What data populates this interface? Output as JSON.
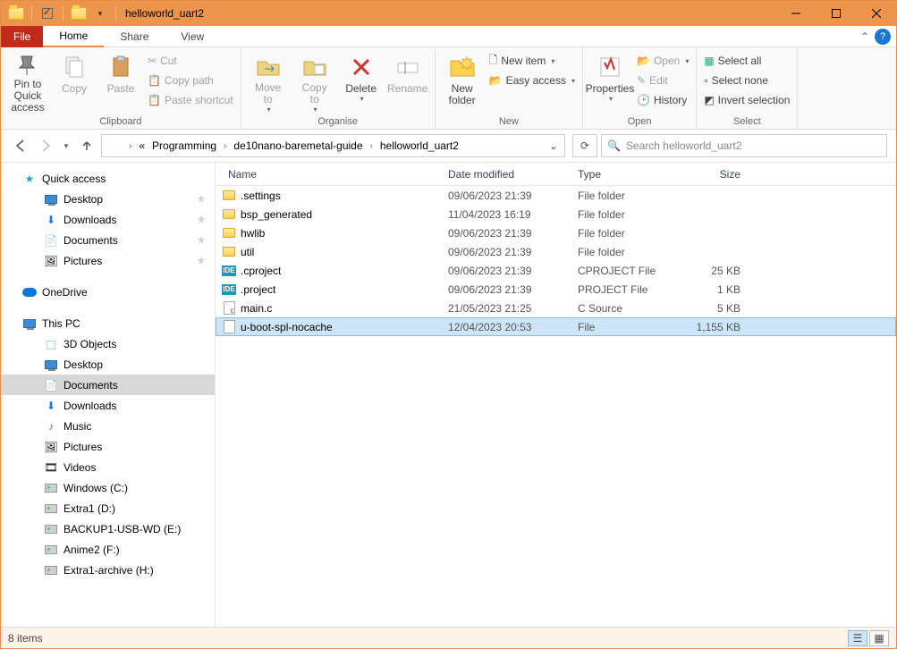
{
  "window": {
    "title": "helloworld_uart2"
  },
  "tabs": {
    "file": "File",
    "home": "Home",
    "share": "Share",
    "view": "View"
  },
  "ribbon": {
    "clipboard": {
      "pin": "Pin to Quick\naccess",
      "copy": "Copy",
      "paste": "Paste",
      "cut": "Cut",
      "copypath": "Copy path",
      "pasteshortcut": "Paste shortcut",
      "label": "Clipboard"
    },
    "organise": {
      "moveto": "Move\nto",
      "copyto": "Copy\nto",
      "delete": "Delete",
      "rename": "Rename",
      "label": "Organise"
    },
    "new": {
      "newfolder": "New\nfolder",
      "newitem": "New item",
      "easyaccess": "Easy access",
      "label": "New"
    },
    "open": {
      "properties": "Properties",
      "open": "Open",
      "edit": "Edit",
      "history": "History",
      "label": "Open"
    },
    "select": {
      "selectall": "Select all",
      "selectnone": "Select none",
      "invert": "Invert selection",
      "label": "Select"
    }
  },
  "breadcrumb": {
    "seg0": "«",
    "seg1": "Programming",
    "seg2": "de10nano-baremetal-guide",
    "seg3": "helloworld_uart2"
  },
  "search": {
    "placeholder": "Search helloworld_uart2"
  },
  "nav": {
    "quickaccess": "Quick access",
    "desktop": "Desktop",
    "downloads": "Downloads",
    "documents": "Documents",
    "pictures": "Pictures",
    "onedrive": "OneDrive",
    "thispc": "This PC",
    "objects3d": "3D Objects",
    "desktop2": "Desktop",
    "documents2": "Documents",
    "downloads2": "Downloads",
    "music": "Music",
    "pictures2": "Pictures",
    "videos": "Videos",
    "windows": "Windows (C:)",
    "extra1": "Extra1 (D:)",
    "backup": "BACKUP1-USB-WD (E:)",
    "anime2": "Anime2 (F:)",
    "extra1a": "Extra1-archive (H:)"
  },
  "columns": {
    "name": "Name",
    "date": "Date modified",
    "type": "Type",
    "size": "Size"
  },
  "files": [
    {
      "name": ".settings",
      "date": "09/06/2023 21:39",
      "type": "File folder",
      "size": "",
      "icon": "folder"
    },
    {
      "name": "bsp_generated",
      "date": "11/04/2023 16:19",
      "type": "File folder",
      "size": "",
      "icon": "folder"
    },
    {
      "name": "hwlib",
      "date": "09/06/2023 21:39",
      "type": "File folder",
      "size": "",
      "icon": "folder"
    },
    {
      "name": "util",
      "date": "09/06/2023 21:39",
      "type": "File folder",
      "size": "",
      "icon": "folder"
    },
    {
      "name": ".cproject",
      "date": "09/06/2023 21:39",
      "type": "CPROJECT File",
      "size": "25 KB",
      "icon": "ide"
    },
    {
      "name": ".project",
      "date": "09/06/2023 21:39",
      "type": "PROJECT File",
      "size": "1 KB",
      "icon": "ide"
    },
    {
      "name": "main.c",
      "date": "21/05/2023 21:25",
      "type": "C Source",
      "size": "5 KB",
      "icon": "c"
    },
    {
      "name": "u-boot-spl-nocache",
      "date": "12/04/2023 20:53",
      "type": "File",
      "size": "1,155 KB",
      "icon": "file"
    }
  ],
  "status": {
    "count": "8 items"
  }
}
